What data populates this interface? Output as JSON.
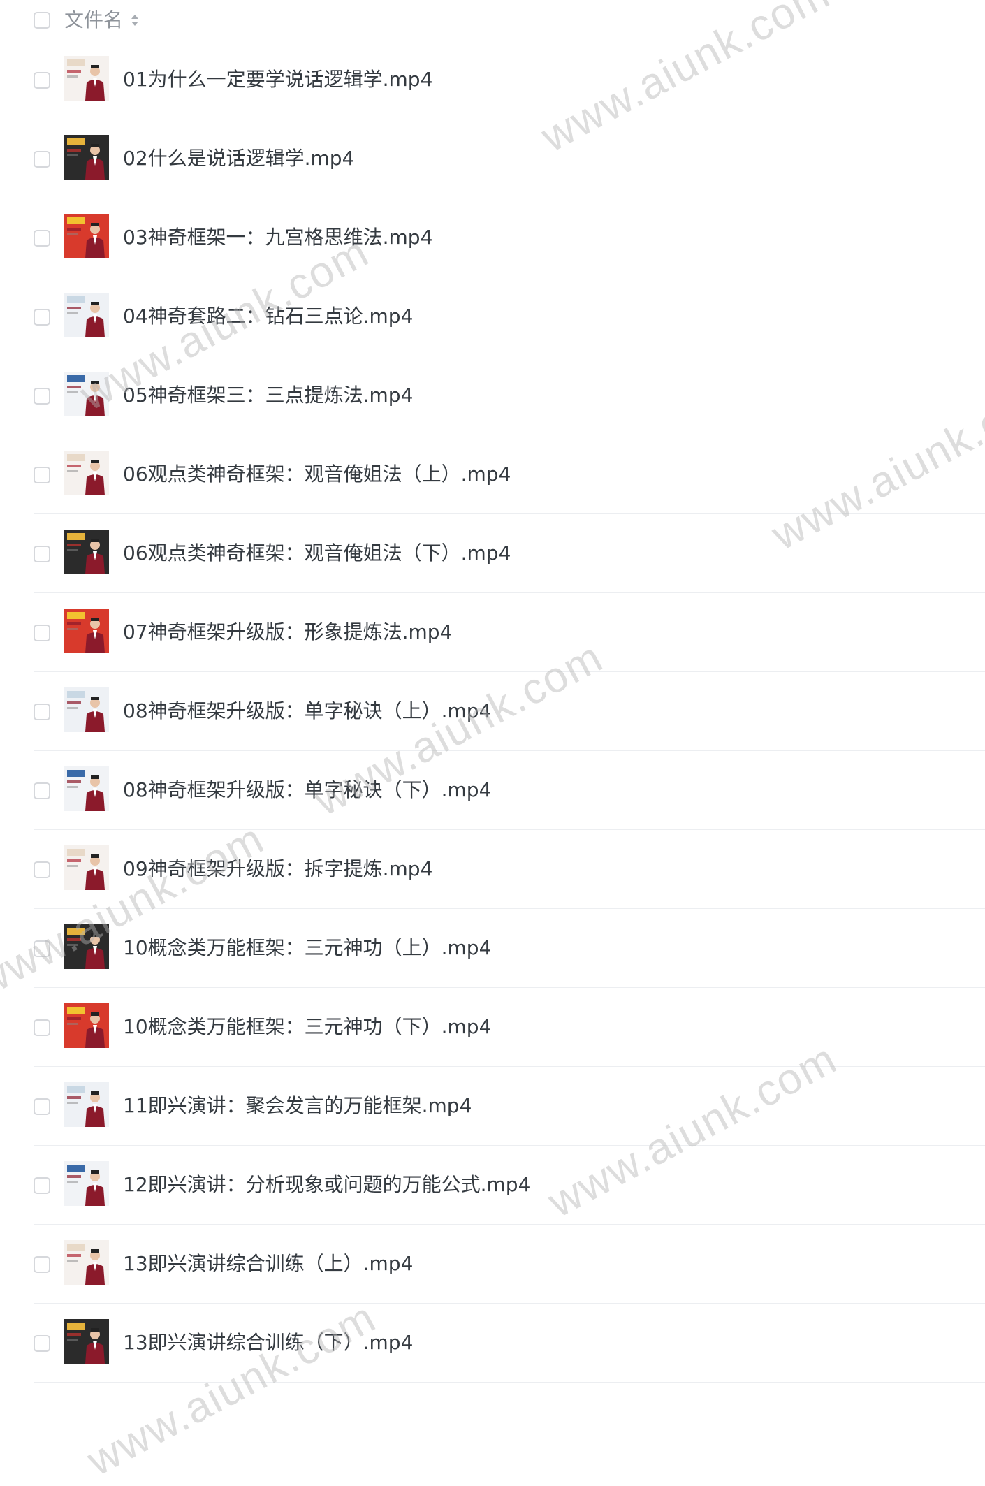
{
  "header": {
    "column_label": "文件名",
    "sort_icon": "sort-icon"
  },
  "files": [
    {
      "name": "01为什么一定要学说话逻辑学.mp4"
    },
    {
      "name": "02什么是说话逻辑学.mp4"
    },
    {
      "name": "03神奇框架一：九宫格思维法.mp4"
    },
    {
      "name": "04神奇套路二：钻石三点论.mp4"
    },
    {
      "name": "05神奇框架三：三点提炼法.mp4"
    },
    {
      "name": "06观点类神奇框架：观音俺姐法（上）.mp4"
    },
    {
      "name": "06观点类神奇框架：观音俺姐法（下）.mp4"
    },
    {
      "name": "07神奇框架升级版：形象提炼法.mp4"
    },
    {
      "name": "08神奇框架升级版：单字秘诀（上）.mp4"
    },
    {
      "name": "08神奇框架升级版：单字秘诀（下）.mp4"
    },
    {
      "name": "09神奇框架升级版：拆字提炼.mp4"
    },
    {
      "name": "10概念类万能框架：三元神功（上）.mp4"
    },
    {
      "name": "10概念类万能框架：三元神功（下）.mp4"
    },
    {
      "name": "11即兴演讲：聚会发言的万能框架.mp4"
    },
    {
      "name": "12即兴演讲：分析现象或问题的万能公式.mp4"
    },
    {
      "name": "13即兴演讲综合训练（上）.mp4"
    },
    {
      "name": "13即兴演讲综合训练（下）.mp4"
    }
  ],
  "watermark": {
    "text": "www.aiunk.com"
  },
  "colors": {
    "checkbox_border": "#d6d8dc",
    "header_text": "#8e939a",
    "file_text": "#343a40",
    "row_divider": "#eceef1",
    "suit_red": "#8b1a2b"
  }
}
